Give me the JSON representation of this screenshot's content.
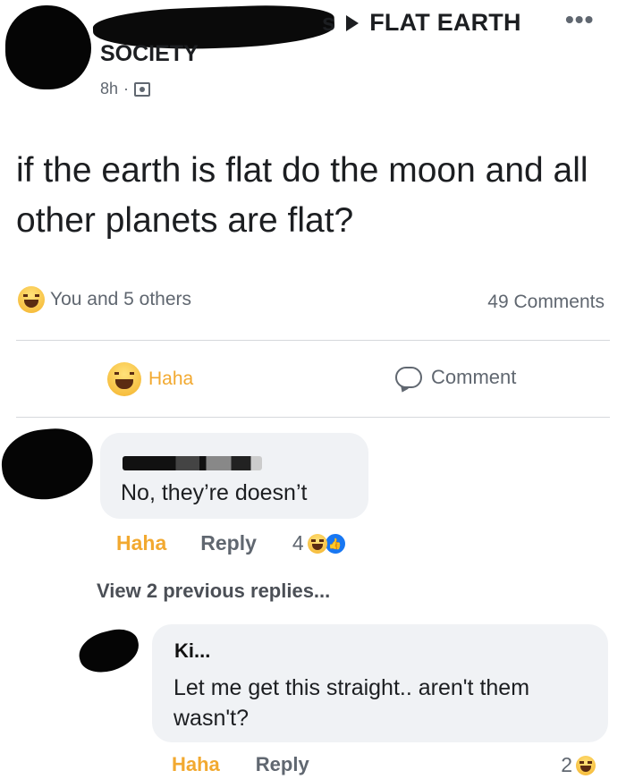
{
  "post": {
    "group_suffix": "s",
    "group_name": "FLAT EARTH",
    "group_name_line2": "SOCIETY",
    "more_icon": "ellipsis-icon",
    "time": "8h",
    "privacy_icon": "group-privacy-icon",
    "text": "if the earth is flat do the moon and all other planets are flat?",
    "reactions_summary": "You and 5 others",
    "reaction_icon": "haha-reaction-icon",
    "comments_count": "49 Comments"
  },
  "actions": {
    "haha_label": "Haha",
    "comment_label": "Comment"
  },
  "comments": [
    {
      "text": "No, they’re doesn’t",
      "haha_label": "Haha",
      "reply_label": "Reply",
      "reaction_count": "4"
    }
  ],
  "view_previous": "View 2 previous replies...",
  "reply": {
    "name": "Ki...",
    "text": "Let me get this straight.. aren't them wasn't?",
    "haha_label": "Haha",
    "reply_label": "Reply",
    "reaction_count": "2"
  },
  "colors": {
    "haha_accent": "#f2a930",
    "secondary_text": "#606770",
    "bubble_bg": "#f0f2f5",
    "like_blue": "#1877f2"
  }
}
